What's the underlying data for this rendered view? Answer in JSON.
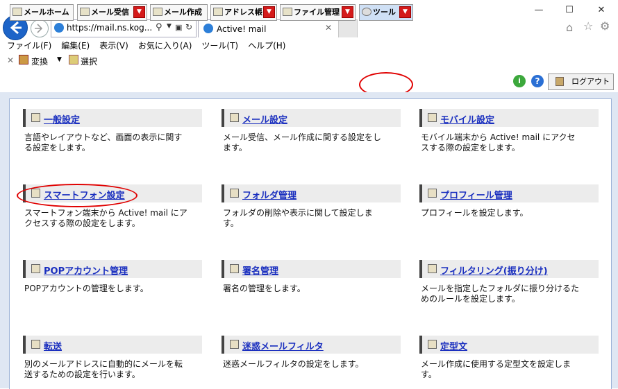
{
  "browser": {
    "url": "https://mail.ns.kog...",
    "tab_title": "Active! mail",
    "menu": [
      "ファイル(F)",
      "編集(E)",
      "表示(V)",
      "お気に入り(A)",
      "ツール(T)",
      "ヘルプ(H)"
    ],
    "cmd_convert": "変換",
    "cmd_select": "選択"
  },
  "toolbar": {
    "tabs": [
      {
        "label": "メールホーム",
        "has_dropdown": false
      },
      {
        "label": "メール受信",
        "has_dropdown": true
      },
      {
        "label": "メール作成",
        "has_dropdown": false
      },
      {
        "label": "アドレス帳",
        "has_dropdown": true
      },
      {
        "label": "ファイル管理",
        "has_dropdown": true
      },
      {
        "label": "ツール",
        "has_dropdown": true,
        "selected": true
      }
    ],
    "logout": "ログアウト"
  },
  "cards": [
    {
      "title": "一般設定",
      "desc": "言語やレイアウトなど、画面の表示に関す\nる設定をします。"
    },
    {
      "title": "メール設定",
      "desc": "メール受信、メール作成に関する設定をし\nます。"
    },
    {
      "title": "モバイル設定",
      "desc": "モバイル端末から Active! mail にアクセ\nスする際の設定をします。"
    },
    {
      "title": "スマートフォン設定",
      "desc": "スマートフォン端末から Active! mail にア\nクセスする際の設定をします。"
    },
    {
      "title": "フォルダ管理",
      "desc": "フォルダの削除や表示に関して設定しま\nす。"
    },
    {
      "title": "プロフィール管理",
      "desc": "プロフィールを設定します。"
    },
    {
      "title": "POPアカウント管理",
      "desc": "POPアカウントの管理をします。"
    },
    {
      "title": "署名管理",
      "desc": "署名の管理をします。"
    },
    {
      "title": "フィルタリング(振り分け)",
      "desc": "メールを指定したフォルダに振り分けるた\nめのルールを設定します。"
    },
    {
      "title": "転送",
      "desc": "別のメールアドレスに自動的にメールを転\n送するための設定を行います。"
    },
    {
      "title": "迷惑メールフィルタ",
      "desc": "迷惑メールフィルタの設定をします。"
    },
    {
      "title": "定型文",
      "desc": "メール作成に使用する定型文を設定しま\nす。"
    }
  ]
}
